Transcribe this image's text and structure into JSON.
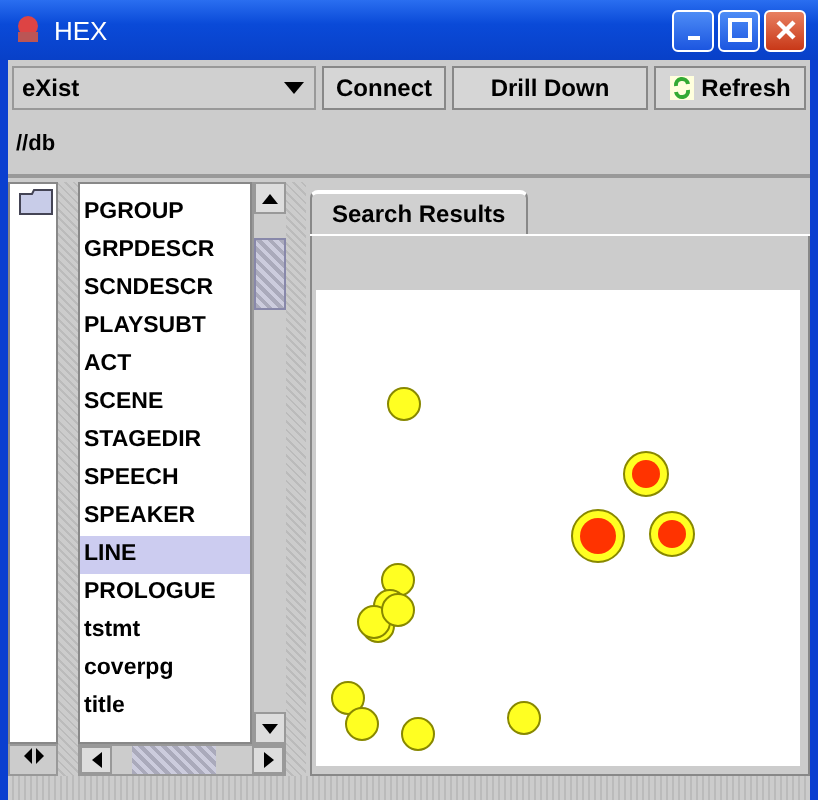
{
  "window": {
    "title": "HEX"
  },
  "toolbar": {
    "database": "eXist",
    "buttons": [
      {
        "label": "Connect",
        "kind": "plain"
      },
      {
        "label": "Drill Down",
        "kind": "plain"
      },
      {
        "label": "Refresh",
        "kind": "refresh"
      }
    ]
  },
  "path": "//db",
  "elements": [
    {
      "label": "PGROUP",
      "selected": false
    },
    {
      "label": "GRPDESCR",
      "selected": false
    },
    {
      "label": "SCNDESCR",
      "selected": false
    },
    {
      "label": "PLAYSUBT",
      "selected": false
    },
    {
      "label": "ACT",
      "selected": false
    },
    {
      "label": "SCENE",
      "selected": false
    },
    {
      "label": "STAGEDIR",
      "selected": false
    },
    {
      "label": "SPEECH",
      "selected": false
    },
    {
      "label": "SPEAKER",
      "selected": false
    },
    {
      "label": "LINE",
      "selected": true
    },
    {
      "label": "PROLOGUE",
      "selected": false
    },
    {
      "label": "tstmt",
      "selected": false
    },
    {
      "label": "coverpg",
      "selected": false
    },
    {
      "label": "title",
      "selected": false
    }
  ],
  "tabs": [
    {
      "label": "Search Results",
      "selected": true
    }
  ]
}
